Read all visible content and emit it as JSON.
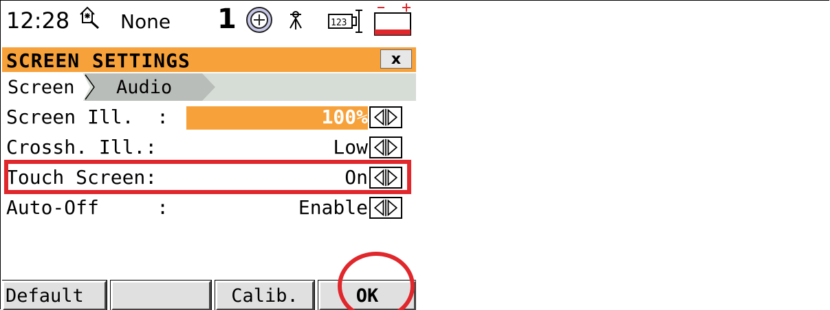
{
  "status": {
    "time": "12:28",
    "target_label": "None",
    "face": "1"
  },
  "title": "SCREEN SETTINGS",
  "close_label": "x",
  "tabs": [
    {
      "label": "Screen"
    },
    {
      "label": "Audio"
    }
  ],
  "rows": [
    {
      "label": "Screen Ill.  :",
      "value": "100%"
    },
    {
      "label": "Crossh. Ill.:",
      "value": "Low"
    },
    {
      "label": "Touch Screen:",
      "value": "On"
    },
    {
      "label": "Auto-Off     :",
      "value": "Enable"
    }
  ],
  "softkeys": [
    "Default",
    "",
    "Calib.",
    "OK"
  ],
  "colors": {
    "accent": "#f7a13a",
    "tab_bar": "#d6dcd6",
    "annotation": "#e0272c"
  },
  "icons": [
    "house-icon",
    "target-icon",
    "tripod-icon",
    "keypad-icon",
    "battery-icon",
    "close-icon",
    "left-right-arrows-icon"
  ]
}
